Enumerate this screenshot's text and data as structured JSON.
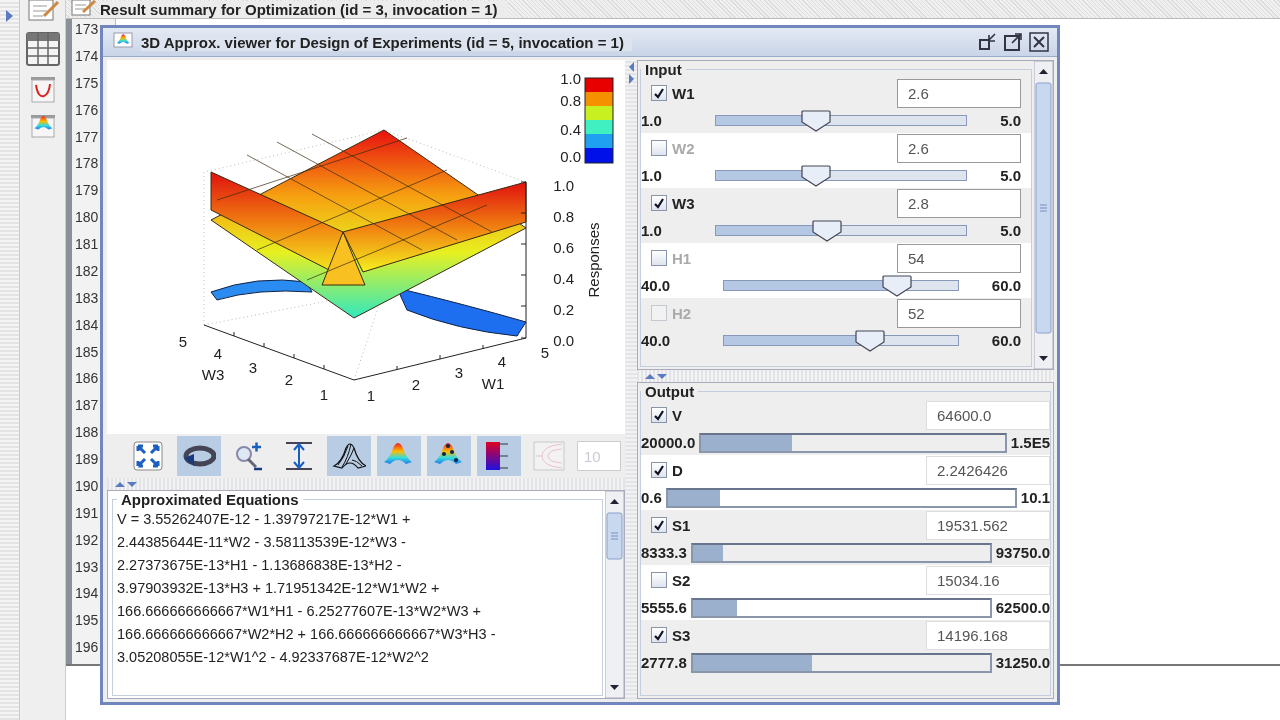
{
  "background_window": {
    "title": "Result summary for Optimization (id = 3, invocation = 1)",
    "row_numbers": [
      "173",
      "174",
      "175",
      "176",
      "177",
      "178",
      "179",
      "180",
      "181",
      "182",
      "183",
      "184",
      "185",
      "186",
      "187",
      "188",
      "189",
      "190",
      "191",
      "192",
      "193",
      "194",
      "195",
      "196"
    ]
  },
  "window": {
    "title": "3D Approx. viewer for Design of Experiments (id = 5, invocation = 1)",
    "plot": {
      "colorbar_ticks": [
        "1.0",
        "0.8",
        "0.4",
        "0.0"
      ],
      "z_ticks": [
        "1.0",
        "0.8",
        "0.6",
        "0.4",
        "0.2",
        "0.0"
      ],
      "z_label": "Responses",
      "w3_ticks": [
        "5",
        "4",
        "3",
        "2",
        "1"
      ],
      "w3_label": "W3",
      "w1_ticks": [
        "1",
        "2",
        "3",
        "4",
        "5"
      ],
      "w1_label": "W1"
    },
    "toolbar": {
      "tools": [
        {
          "kind": "fit",
          "selected": false,
          "disabled": false
        },
        {
          "kind": "rotate",
          "selected": true,
          "disabled": false
        },
        {
          "kind": "zoom",
          "selected": false,
          "disabled": false
        },
        {
          "kind": "scale",
          "selected": false,
          "disabled": false
        },
        {
          "kind": "mesh",
          "selected": true,
          "disabled": false
        },
        {
          "kind": "surface",
          "selected": true,
          "disabled": false
        },
        {
          "kind": "points",
          "selected": true,
          "disabled": false
        },
        {
          "kind": "colorbar",
          "selected": true,
          "disabled": false
        },
        {
          "kind": "contour",
          "selected": false,
          "disabled": true
        }
      ],
      "field": {
        "value": "10",
        "disabled": true
      }
    },
    "equations": {
      "title": "Approximated Equations",
      "lines": [
        "V = 3.55262407E-12 - 1.39797217E-12*W1 +",
        "2.44385644E-11*W2 - 3.58113539E-12*W3 -",
        "2.27373675E-13*H1 - 1.13686838E-13*H2 -",
        "3.97903932E-13*H3 + 1.71951342E-12*W1*W2 +",
        "166.666666666667*W1*H1 - 6.25277607E-13*W2*W3 +",
        "166.666666666667*W2*H2 + 166.666666666667*W3*H3 -",
        "3.05208055E-12*W1^2 - 4.92337687E-12*W2^2"
      ]
    },
    "input": {
      "title": "Input",
      "variables": [
        {
          "name": "W1",
          "checked": true,
          "disabled": false,
          "value": "2.6",
          "min": "1.0",
          "max": "5.0",
          "level": 0.41
        },
        {
          "name": "W2",
          "checked": false,
          "disabled": false,
          "value": "2.6",
          "min": "1.0",
          "max": "5.0",
          "level": 0.41
        },
        {
          "name": "W3",
          "checked": true,
          "disabled": false,
          "value": "2.8",
          "min": "1.0",
          "max": "5.0",
          "level": 0.45
        },
        {
          "name": "H1",
          "checked": false,
          "disabled": false,
          "value": "54",
          "min": "40.0",
          "max": "60.0",
          "level": 0.71
        },
        {
          "name": "H2",
          "checked": false,
          "disabled": true,
          "value": "52",
          "min": "40.0",
          "max": "60.0",
          "level": 0.61
        }
      ]
    },
    "output": {
      "title": "Output",
      "responses": [
        {
          "name": "V",
          "checked": true,
          "value": "64600.0",
          "min": "20000.0",
          "max": "1.5E5",
          "level": 0.3
        },
        {
          "name": "D",
          "checked": true,
          "value": "2.2426426",
          "min": "0.6",
          "max": "10.1",
          "level": 0.15
        },
        {
          "name": "S1",
          "checked": true,
          "value": "19531.562",
          "min": "8333.3",
          "max": "93750.0",
          "level": 0.1
        },
        {
          "name": "S2",
          "checked": false,
          "value": "15034.16",
          "min": "5555.6",
          "max": "62500.0",
          "level": 0.15
        },
        {
          "name": "S3",
          "checked": true,
          "value": "14196.168",
          "min": "2777.8",
          "max": "31250.0",
          "level": 0.4
        }
      ]
    }
  }
}
